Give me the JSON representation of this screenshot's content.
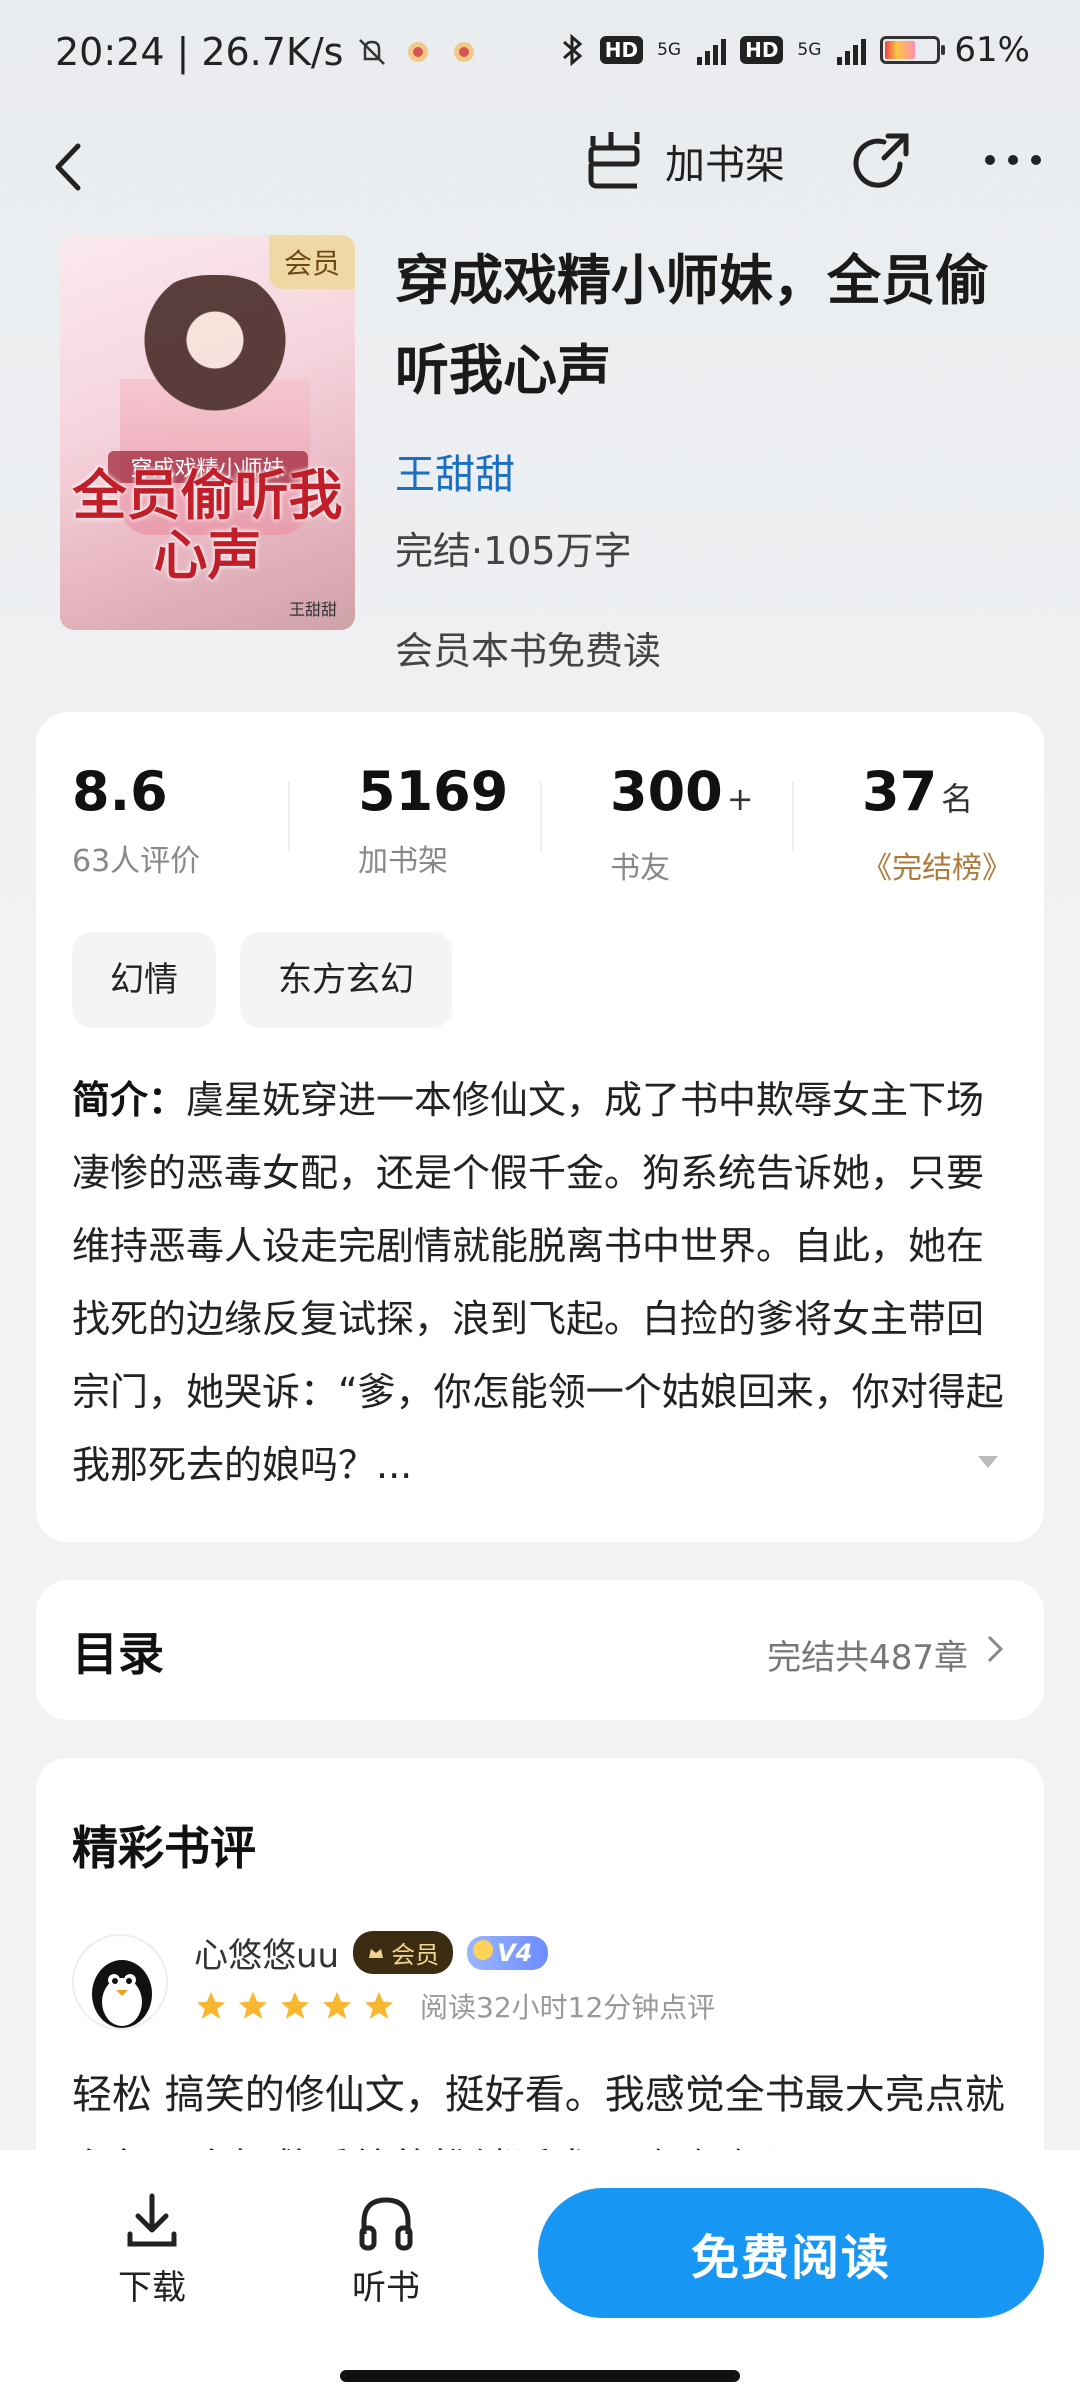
{
  "status_bar": {
    "time": "20:24",
    "speed": "26.7K/s",
    "network1": "5G",
    "network2": "5G",
    "hd": "HD",
    "battery": "61%"
  },
  "nav": {
    "add_shelf": "加书架"
  },
  "book": {
    "cover_badge": "会员",
    "cover_subtitle": "穿成戏精小师妹",
    "cover_title": "全员偷听我心声",
    "cover_author": "王甜甜",
    "title": "穿成戏精小师妹，全员偷听我心声",
    "author": "王甜甜",
    "status": "完结·105万字",
    "vip_read": "会员本书免费读"
  },
  "stats": [
    {
      "value": "8.6",
      "suffix": "",
      "label": "63人评价"
    },
    {
      "value": "5169",
      "suffix": "",
      "label": "加书架"
    },
    {
      "value": "300",
      "suffix": "+",
      "label": "书友"
    },
    {
      "value": "37",
      "suffix": "名",
      "label": "《完结榜》"
    }
  ],
  "tags": [
    "幻情",
    "东方玄幻"
  ],
  "intro": {
    "label": "简介：",
    "text": "虞星妩穿进一本修仙文，成了书中欺辱女主下场凄惨的恶毒女配，还是个假千金。狗系统告诉她，只要维持恶毒人设走完剧情就能脱离书中世界。自此，她在找死的边缘反复试探，浪到飞起。白捡的爹将女主带回宗门，她哭诉：“爹，你怎能领一个姑娘回来，你对得起我那死去的娘吗？..."
  },
  "toc": {
    "title": "目录",
    "summary": "完结共487章"
  },
  "reviews": {
    "title": "精彩书评",
    "items": [
      {
        "user": "心悠悠uu",
        "vip_badge": "会员",
        "level": "V4",
        "rating": 5,
        "read_time": "阅读32小时12分钟点评",
        "text": "轻松 搞笑的修仙文，挺好看。我感觉全书最大亮点就在每一次拯救系统的推销话术，哈哈哈😄"
      }
    ]
  },
  "bottom": {
    "download": "下载",
    "listen": "听书",
    "read": "免费阅读"
  },
  "colors": {
    "accent": "#1796f3",
    "author_link": "#1a6fc4",
    "star": "#f7b731",
    "rank": "#b07a3a"
  }
}
